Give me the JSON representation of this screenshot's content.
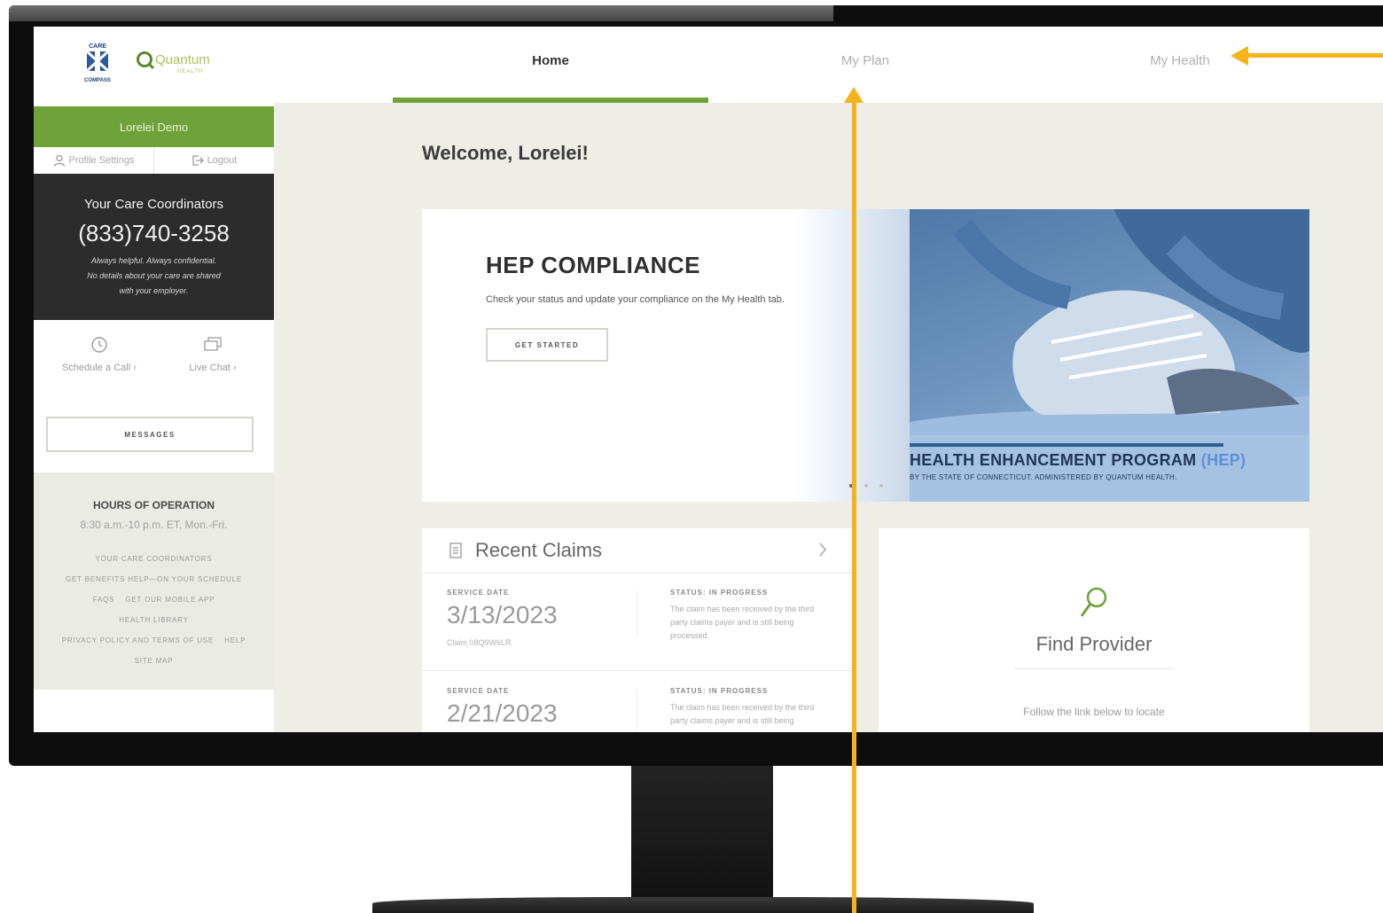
{
  "brand": {
    "care_logo_top": "CARE",
    "care_logo_bottom": "COMPASS",
    "quantum_name": "Quantum",
    "quantum_sub": "HEALTH"
  },
  "sidebar": {
    "user_name": "Lorelei Demo",
    "profile_settings": "Profile Settings",
    "logout": "Logout",
    "coordinators": {
      "title": "Your Care Coordinators",
      "phone": "(833)740-3258",
      "line1": "Always helpful. Always confidential.",
      "line2": "No details about your care are shared",
      "line3": "with your employer."
    },
    "schedule_call": "Schedule a Call",
    "live_chat": "Live Chat",
    "messages_button": "MESSAGES",
    "hours_title": "HOURS OF OPERATION",
    "hours_time": "8:30 a.m.-10 p.m. ET, Mon.-Fri.",
    "links": {
      "care_coordinators": "YOUR CARE COORDINATORS",
      "benefits_help": "GET BENEFITS HELP—ON YOUR SCHEDULE",
      "faqs": "FAQS",
      "mobile_app": "GET OUR MOBILE APP",
      "health_library": "HEALTH LIBRARY",
      "privacy": "PRIVACY POLICY AND TERMS OF USE",
      "help": "HELP",
      "site_map": "SITE MAP"
    }
  },
  "nav": {
    "tabs": [
      {
        "label": "Home",
        "active": true
      },
      {
        "label": "My Plan",
        "active": false
      },
      {
        "label": "My Health",
        "active": false
      }
    ]
  },
  "welcome": "Welcome, Lorelei!",
  "hero": {
    "title": "HEP COMPLIANCE",
    "description": "Check your status and update your compliance on the My Health tab.",
    "button": "GET STARTED",
    "banner_title": "HEALTH ENHANCEMENT PROGRAM",
    "banner_title_accent": "(HEP)",
    "banner_subtitle": "BY THE STATE OF CONNECTICUT. ADMINISTERED BY QUANTUM HEALTH."
  },
  "claims": {
    "title": "Recent Claims",
    "items": [
      {
        "service_date_label": "SERVICE DATE",
        "service_date": "3/13/2023",
        "claim_id": "Claim 08Q9W6LR",
        "status_label": "STATUS: IN PROGRESS",
        "status_text": "The claim has been received by the third party claims payer and is still being processed."
      },
      {
        "service_date_label": "SERVICE DATE",
        "service_date": "2/21/2023",
        "status_label": "STATUS: IN PROGRESS",
        "status_text": "The claim has been received by the third party claims payer and is still being"
      }
    ]
  },
  "provider": {
    "title": "Find Provider",
    "description": "Follow the link below to locate"
  },
  "colors": {
    "accent_green": "#6fa33a",
    "annotation_yellow": "#f4b41a",
    "dark_panel": "#2c2c2c"
  },
  "icons": [
    "user-icon",
    "logout-icon",
    "clock-icon",
    "chat-icon",
    "document-icon",
    "chevron-right-icon",
    "search-icon"
  ]
}
